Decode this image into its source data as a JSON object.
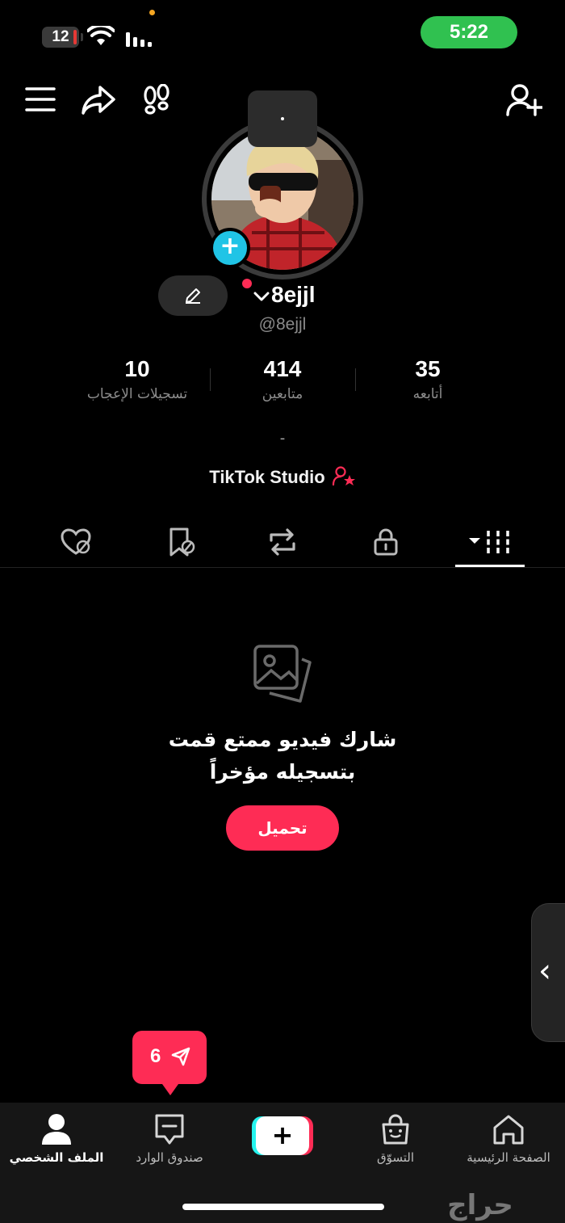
{
  "status_bar": {
    "battery": "12",
    "time": "5:22"
  },
  "profile": {
    "username": "8ejjl",
    "handle": "@8ejjl",
    "stats": [
      {
        "key": "following",
        "value": "35",
        "label": "أتابعه"
      },
      {
        "key": "followers",
        "value": "414",
        "label": "متابعين"
      },
      {
        "key": "likes",
        "value": "10",
        "label": "تسجيلات الإعجاب"
      }
    ],
    "bio": "-",
    "studio_link": "TikTok Studio"
  },
  "empty_state": {
    "line1": "شارك فيديو ممتع قمت",
    "line2": "بتسجيله مؤخراً",
    "button": "تحميل"
  },
  "inbox_badge": {
    "count": "6"
  },
  "bottom_nav": {
    "home": "الصفحة الرئيسية",
    "shop": "التسوّق",
    "create": "+",
    "inbox": "صندوق الوارد",
    "profile": "الملف الشخصي"
  },
  "watermark": "حراج",
  "colors": {
    "accent": "#fe2c55",
    "cyan": "#25f4ee",
    "status_green": "#30c150",
    "badge_blue": "#20c4e6"
  }
}
